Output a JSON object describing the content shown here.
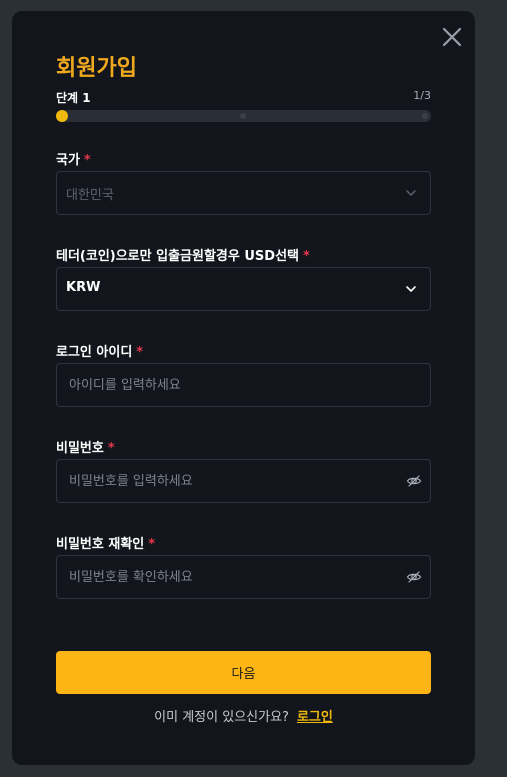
{
  "modal": {
    "title": "회원가입",
    "step_label": "단계 1",
    "step_count": "1/3",
    "progress_fraction": 0.0
  },
  "fields": {
    "country": {
      "label": "국가",
      "required_mark": "*",
      "value": "대한민국"
    },
    "currency": {
      "label": "테더(코인)으로만 입출금원할경우 USD선택",
      "required_mark": "*",
      "value": "KRW"
    },
    "login_id": {
      "label": "로그인 아이디",
      "required_mark": "*",
      "placeholder": "아이디를 입력하세요"
    },
    "password": {
      "label": "비밀번호",
      "required_mark": "*",
      "placeholder": "비밀번호를 입력하세요"
    },
    "password_confirm": {
      "label": "비밀번호 재확인",
      "required_mark": "*",
      "placeholder": "비밀번호를 확인하세요"
    }
  },
  "actions": {
    "next_label": "다음"
  },
  "footer": {
    "question": "이미 계정이 있으신가요?",
    "login_link": "로그인"
  },
  "colors": {
    "accent": "#f0b90b",
    "required": "#e8354e",
    "background": "#12161c"
  },
  "icons": {
    "close": "close-icon",
    "chevron": "chevron-down-icon",
    "eye": "eye-off-icon"
  }
}
